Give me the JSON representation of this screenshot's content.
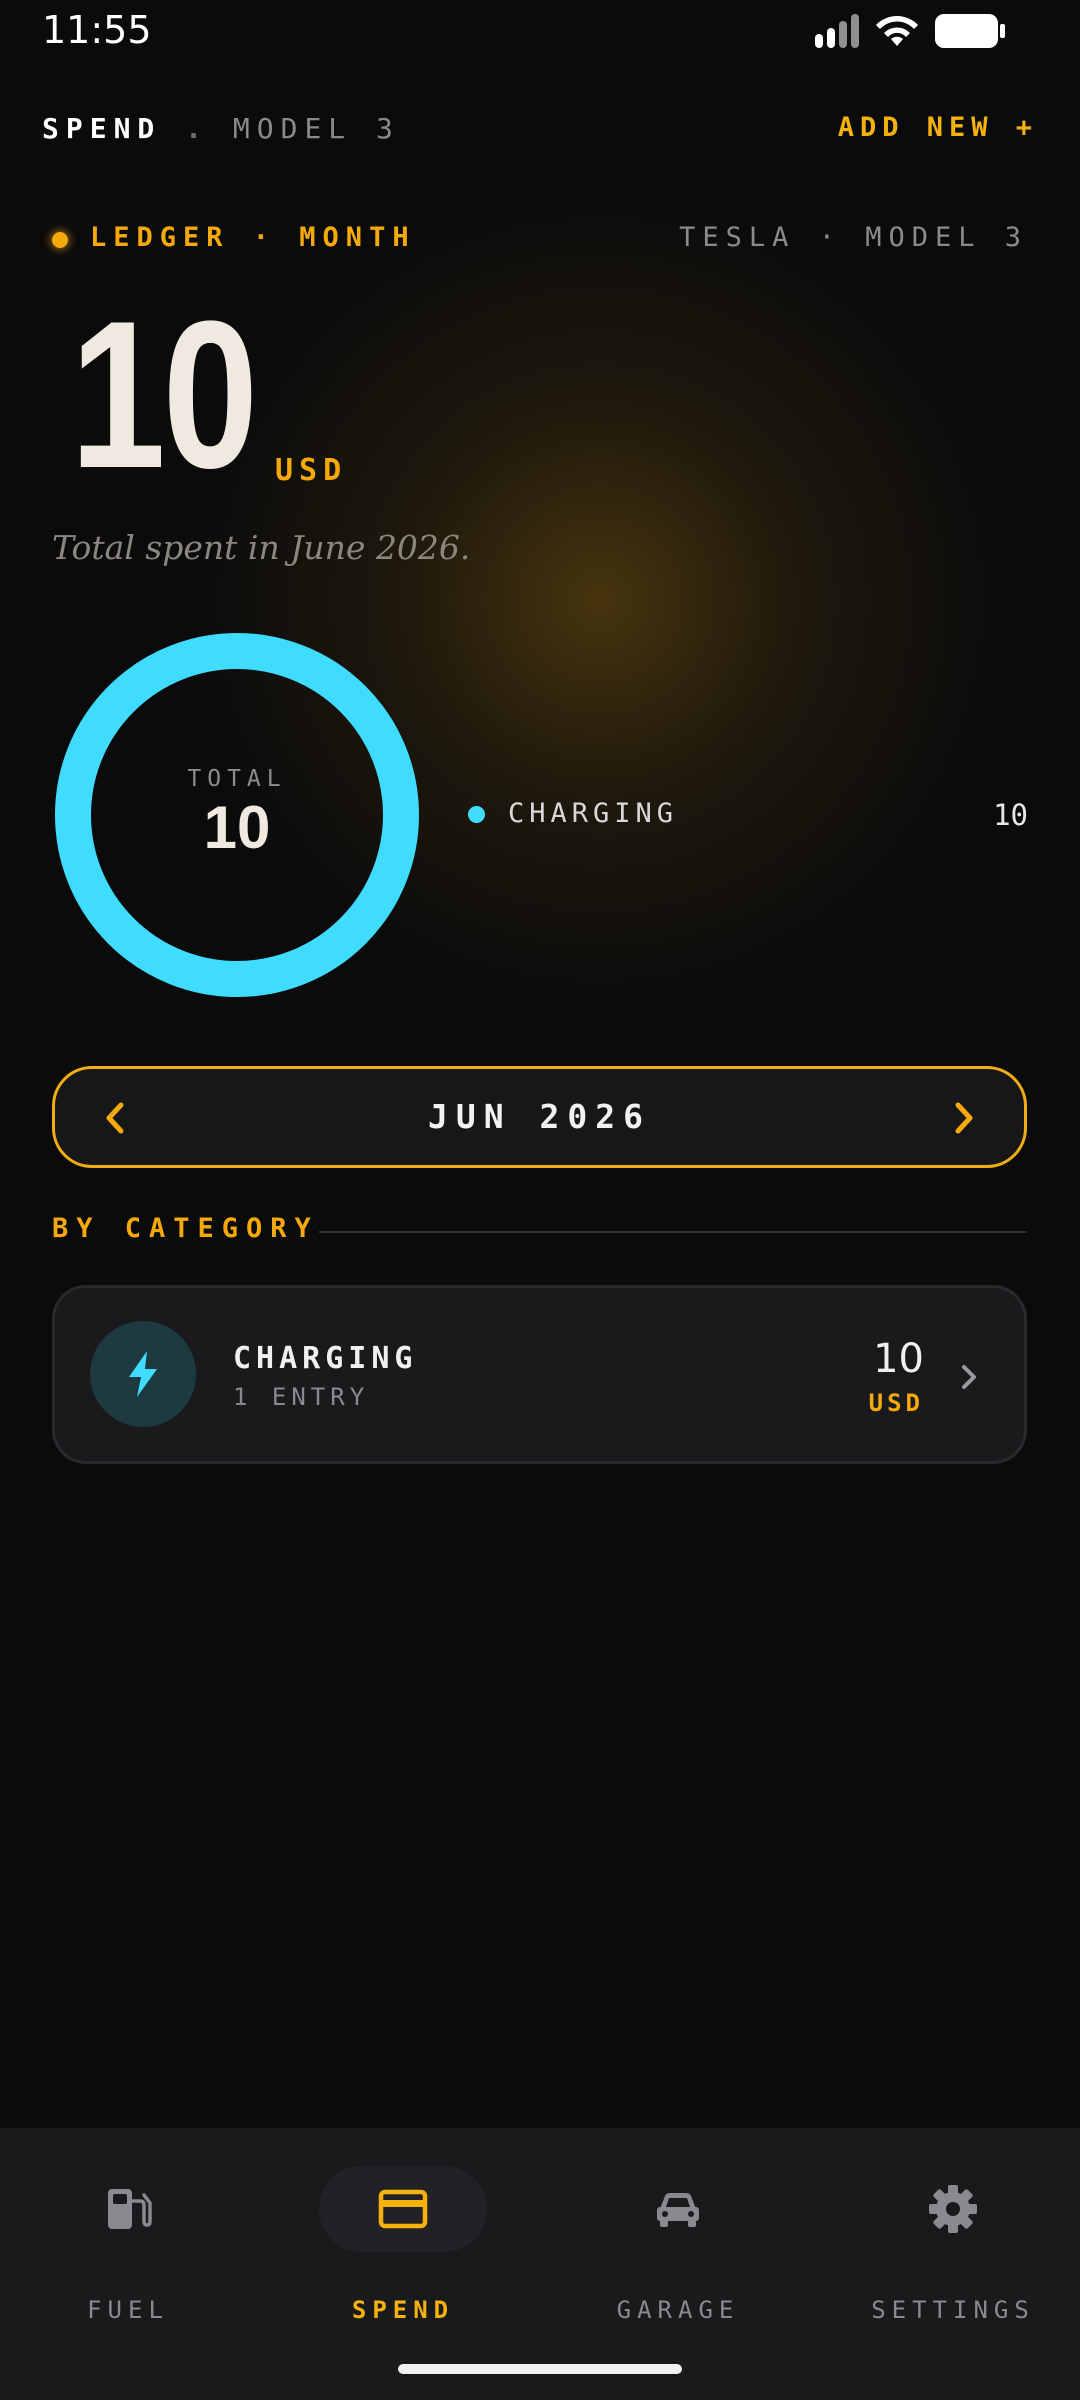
{
  "status_bar": {
    "time": "11:55"
  },
  "header": {
    "section": "SPEND",
    "separator": ".",
    "model": "MODEL 3",
    "add_new": "ADD NEW +"
  },
  "ledger": {
    "label": "LEDGER · MONTH",
    "vehicle": "TESLA · MODEL 3"
  },
  "summary": {
    "total": "10",
    "currency": "USD",
    "subtitle": "Total spent in June 2026."
  },
  "chart_data": {
    "type": "pie",
    "categories": [
      "CHARGING"
    ],
    "values": [
      10
    ],
    "center_label": "TOTAL",
    "center_value": "10",
    "colors": [
      "#3fdcff"
    ]
  },
  "legend": [
    {
      "name": "CHARGING",
      "value": "10",
      "color": "#3fdcff"
    }
  ],
  "month_nav": {
    "label": "JUN 2026",
    "prev_icon": "chevron-left-icon",
    "next_icon": "chevron-right-icon"
  },
  "by_category": {
    "title": "BY CATEGORY",
    "items": [
      {
        "icon": "lightning-bolt-icon",
        "name": "CHARGING",
        "entries": "1 ENTRY",
        "amount": "10",
        "currency": "USD"
      }
    ]
  },
  "bottom_nav": [
    {
      "label": "FUEL",
      "icon": "fuel-pump-icon",
      "active": false
    },
    {
      "label": "SPEND",
      "icon": "credit-card-icon",
      "active": true
    },
    {
      "label": "GARAGE",
      "icon": "car-icon",
      "active": false
    },
    {
      "label": "SETTINGS",
      "icon": "gear-icon",
      "active": false
    }
  ],
  "colors": {
    "accent": "#f5a90a",
    "charging": "#3fdcff",
    "background": "#0b0b0c"
  }
}
